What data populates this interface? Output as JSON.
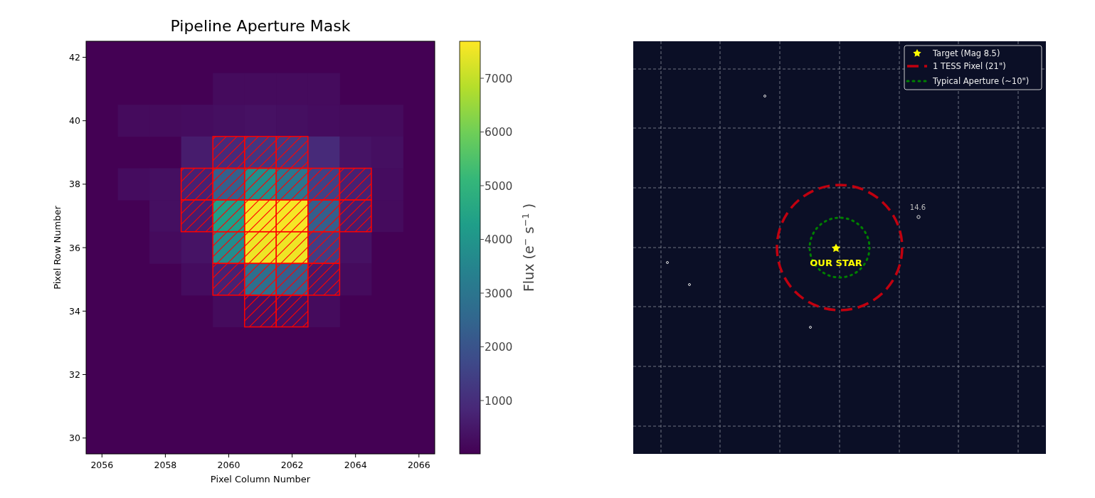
{
  "left_panel": {
    "title": "Pipeline Aperture Mask",
    "xlabel": "Pixel Column Number",
    "ylabel": "Pixel Row Number",
    "xticks": [
      "2056",
      "2058",
      "2060",
      "2062",
      "2064",
      "2066"
    ],
    "yticks": [
      "42",
      "40",
      "38",
      "36",
      "34",
      "32",
      "30"
    ],
    "colorbar": {
      "label": "Flux (e$^{−}$ s$^{−1}$)",
      "ticks": [
        "7000",
        "6000",
        "5000",
        "4000",
        "3000",
        "2000",
        "1000"
      ]
    }
  },
  "right_panel": {
    "target_label": "OUR STAR",
    "field_star_labels": [
      "14.6"
    ],
    "legend": [
      {
        "label": "Target (Mag 8.5)",
        "kind": "star",
        "color": "#ffff00"
      },
      {
        "label": "1 TESS Pixel (21\")",
        "kind": "dashed",
        "color": "#c0000f"
      },
      {
        "label": "Typical Aperture (~10\")",
        "kind": "dotted",
        "color": "#008000"
      }
    ]
  }
}
